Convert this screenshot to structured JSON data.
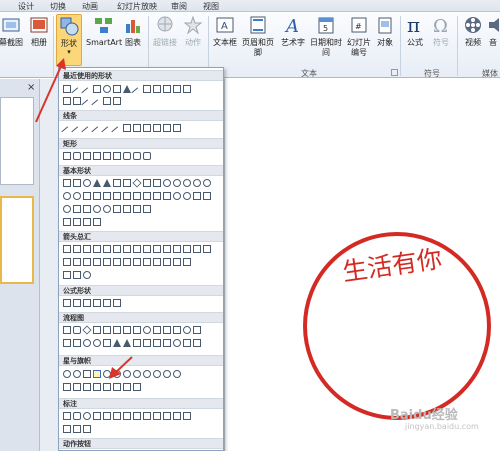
{
  "tabs": [
    "设计",
    "切换",
    "动画",
    "幻灯片放映",
    "审阅",
    "视图"
  ],
  "ribbon": {
    "buttons": {
      "screenshot": "幕截图",
      "album": "相册",
      "shapes": "形状",
      "smartart": "SmartArt",
      "chart": "图表",
      "hyperlink": "超链接",
      "action": "动作",
      "textbox": "文本框",
      "header_footer": "页眉和页脚",
      "wordart": "艺术字",
      "datetime": "日期和时间",
      "slide_number_line1": "幻灯片",
      "slide_number_line2": "编号",
      "object": "对象",
      "equation": "公式",
      "symbol": "符号",
      "video": "视频",
      "audio": "音"
    },
    "groups": {
      "text": "文本",
      "symbols": "符号",
      "media": "媒体"
    }
  },
  "panel": {
    "close": "×"
  },
  "dropdown": {
    "categories": {
      "recent": "最近使用的形状",
      "lines": "线条",
      "rectangles": "矩形",
      "basic": "基本形状",
      "block_arrows": "箭头总汇",
      "equation": "公式形状",
      "flowchart": "流程图",
      "stars": "星与旗帜",
      "callouts": "标注",
      "action_buttons": "动作按钮"
    }
  },
  "slide": {
    "stamp_text": "生活有你",
    "stamp_color": "#d42a24"
  },
  "watermark": {
    "text": "Baidu经验",
    "url": "jingyan.baidu.com"
  },
  "colors": {
    "accent": "#fbd77a",
    "arrow": "#d9342b"
  }
}
